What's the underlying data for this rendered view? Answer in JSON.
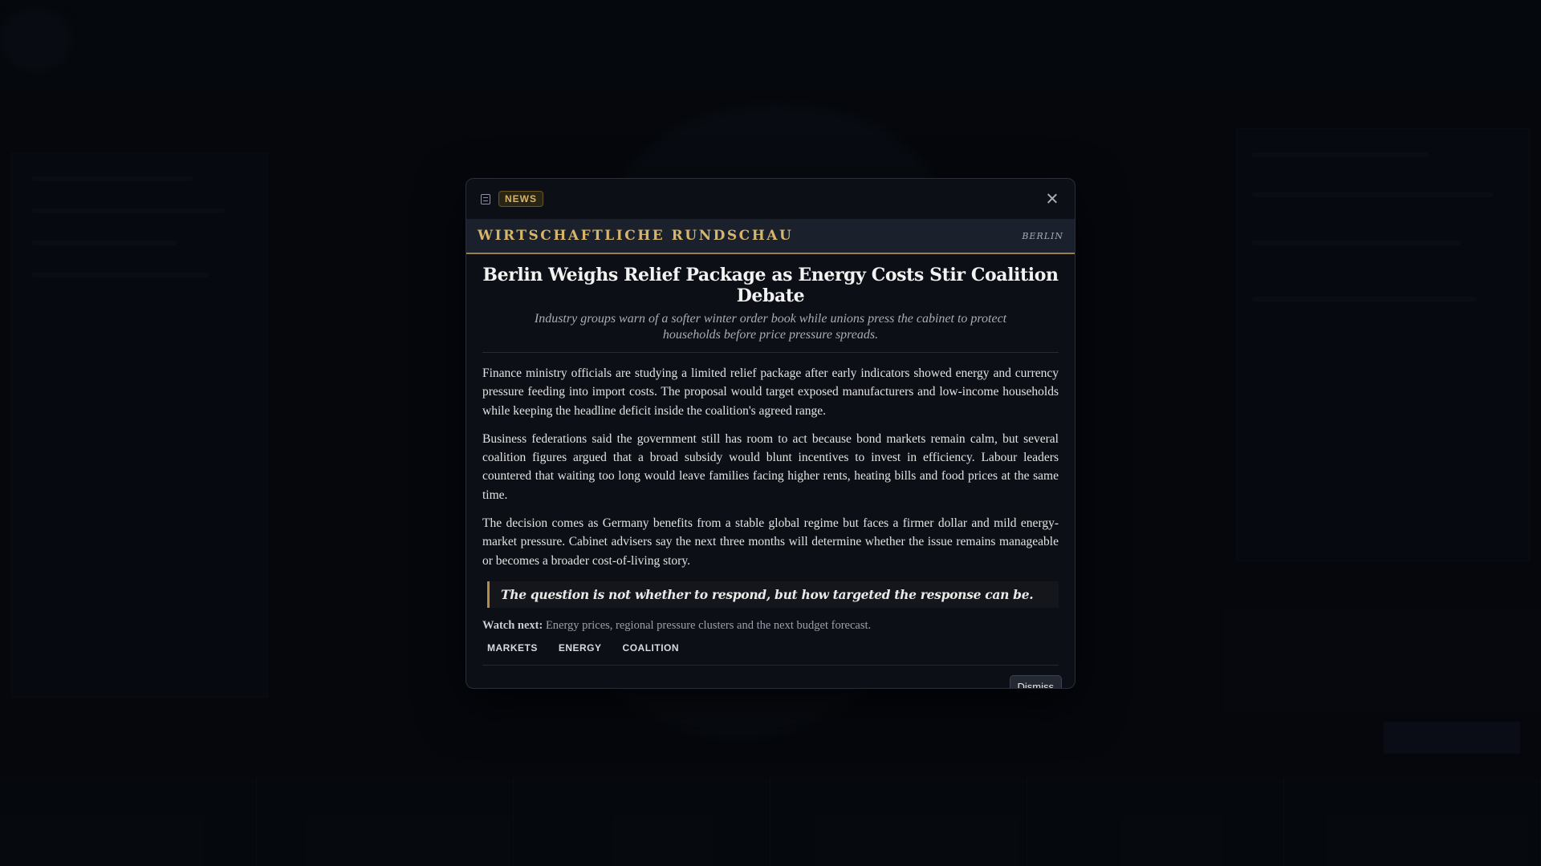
{
  "badge": {
    "label": "NEWS"
  },
  "masthead": {
    "name": "WIRTSCHAFTLICHE RUNDSCHAU",
    "city": "BERLIN"
  },
  "article": {
    "headline": "Berlin Weighs Relief Package as Energy Costs Stir Coalition Debate",
    "dek": "Industry groups warn of a softer winter order book while unions press the cabinet to protect households before price pressure spreads.",
    "paragraphs": [
      "Finance ministry officials are studying a limited relief package after early indicators showed energy and currency pressure feeding into import costs. The proposal would target exposed manufacturers and low-income households while keeping the headline deficit inside the coalition's agreed range.",
      "Business federations said the government still has room to act because bond markets remain calm, but several coalition figures argued that a broad subsidy would blunt incentives to invest in efficiency. Labour leaders countered that waiting too long would leave families facing higher rents, heating bills and food prices at the same time.",
      "The decision comes as Germany benefits from a stable global regime but faces a firmer dollar and mild energy-market pressure. Cabinet advisers say the next three months will determine whether the issue remains manageable or becomes a broader cost-of-living story."
    ],
    "quote": "The question is not whether to respond, but how targeted the response can be.",
    "watch_next_label": "Watch next:",
    "watch_next_text": "Energy prices, regional pressure clusters and the next budget forecast.",
    "tags": [
      "MARKETS",
      "ENERGY",
      "COALITION"
    ]
  },
  "footer": {
    "dismiss_label": "Dismiss"
  },
  "icons": {
    "badge_icon": "news-document-icon",
    "close_icon": "close-icon"
  },
  "colors": {
    "accent_gold": "#d7b56b",
    "masthead_bg": "#1a212d",
    "modal_bg": "#0c0f15"
  }
}
